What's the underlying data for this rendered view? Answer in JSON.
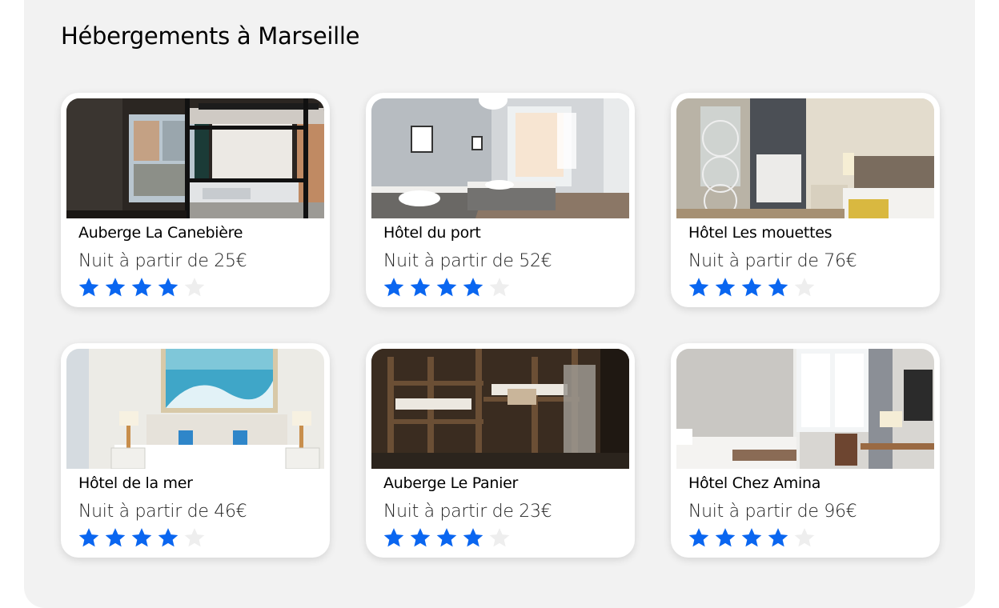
{
  "page": {
    "title": "Hébergements à Marseille"
  },
  "colors": {
    "star_active": "#0a66f0",
    "star_inactive": "#eeeeee",
    "section_background": "#f2f2f2",
    "card_background": "#ffffff"
  },
  "rating_icon": "star-icon",
  "rating_max": 5,
  "hotels": [
    {
      "name": "Auberge La Canebière",
      "price": "Nuit à partir de 25€",
      "rating": 4,
      "photo": "dorm-bunk-beds-photo"
    },
    {
      "name": "Hôtel du port",
      "price": "Nuit à partir de 52€",
      "rating": 4,
      "photo": "twin-room-photo"
    },
    {
      "name": "Hôtel Les mouettes",
      "price": "Nuit à partir de 76€",
      "rating": 4,
      "photo": "bedroom-wardrobe-photo"
    },
    {
      "name": "Hôtel de la mer",
      "price": "Nuit à partir de 46€",
      "rating": 4,
      "photo": "bedroom-wave-painting-photo"
    },
    {
      "name": "Auberge Le Panier",
      "price": "Nuit à partir de 23€",
      "rating": 4,
      "photo": "wooden-bunk-dorm-photo"
    },
    {
      "name": "Hôtel Chez Amina",
      "price": "Nuit à partir de 96€",
      "rating": 4,
      "photo": "bedroom-window-desk-photo"
    }
  ]
}
